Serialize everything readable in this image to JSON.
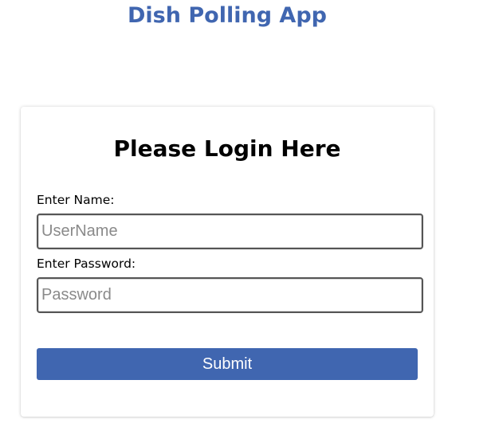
{
  "header": {
    "title": "Dish Polling App"
  },
  "login": {
    "heading": "Please Login Here",
    "name_label": "Enter Name:",
    "name_placeholder": "UserName",
    "name_value": "",
    "password_label": "Enter Password:",
    "password_placeholder": "Password",
    "password_value": "",
    "submit_label": "Submit"
  },
  "colors": {
    "brand": "#4066b0",
    "button_text": "#ffffff"
  }
}
